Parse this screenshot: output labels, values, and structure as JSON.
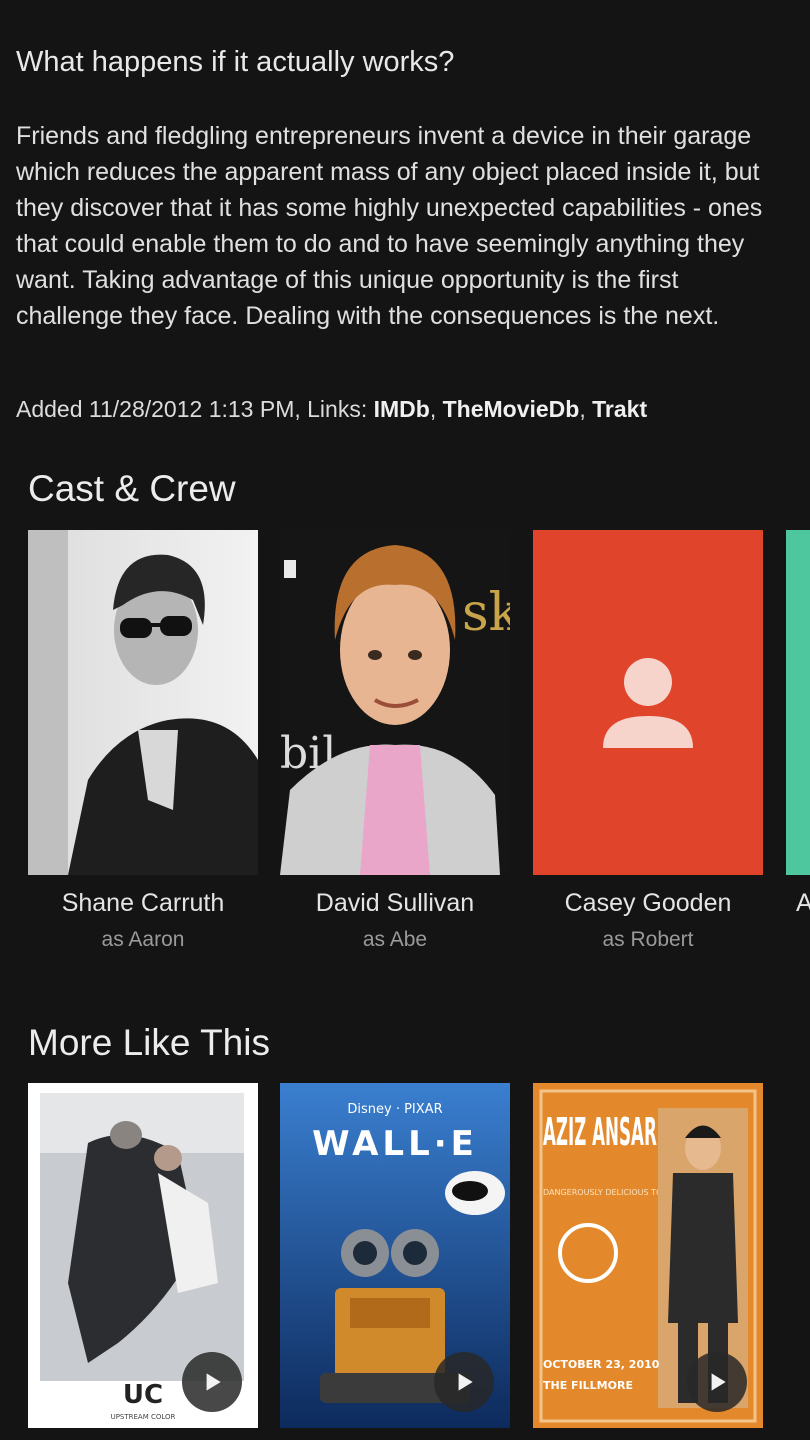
{
  "details": {
    "tagline": "What happens if it actually works?",
    "overview": "Friends and fledgling entrepreneurs invent a device in their garage which reduces the apparent mass of any object placed inside it, but they discover that it has some highly unexpected capabilities - ones that could enable them to do and to have seemingly anything they want. Taking advantage of this unique opportunity is the first challenge they face. Dealing with the consequences is the next.",
    "added_label": "Added 11/28/2012 1:13 PM, Links: ",
    "links": [
      "IMDb",
      "TheMovieDb",
      "Trakt"
    ],
    "link_separator": ", "
  },
  "cast": {
    "title": "Cast & Crew",
    "people": [
      {
        "name": "Shane Carruth",
        "role": "as Aaron"
      },
      {
        "name": "David Sullivan",
        "role": "as Abe"
      },
      {
        "name": "Casey Gooden",
        "role": "as Robert"
      },
      {
        "name": "A",
        "role": ""
      }
    ],
    "placeholder_color": "#e0452c",
    "next_card_color": "#4fc79e"
  },
  "more": {
    "title": "More Like This",
    "items": [
      {
        "poster_title": "UPSTREAM COLOR"
      },
      {
        "poster_title": "WALL·E",
        "poster_brand": "Disney · PIXAR"
      },
      {
        "poster_title": "AZIZ ANSARI",
        "poster_subtitle": "DANGEROUSLY DELICIOUS TOUR",
        "poster_date": "OCTOBER 23, 2010",
        "poster_venue": "THE FILLMORE"
      }
    ]
  }
}
